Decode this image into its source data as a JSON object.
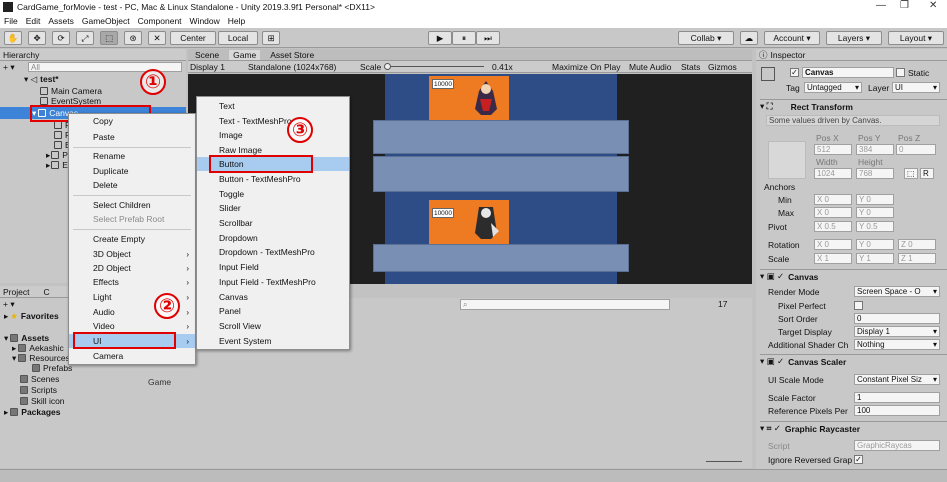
{
  "window": {
    "title": "CardGame_forMovie - test - PC, Mac & Linux Standalone - Unity 2019.3.9f1 Personal* <DX11>",
    "minimize": "—",
    "maximize": "❐",
    "close": "✕"
  },
  "menubar": [
    "File",
    "Edit",
    "Assets",
    "GameObject",
    "Component",
    "Window",
    "Help"
  ],
  "toolbar": {
    "tools": [
      "✋",
      "✥",
      "⟳",
      "⤢",
      "⬚",
      "⊛",
      "✕"
    ],
    "pivot": "Center",
    "space": "Local",
    "snap": "⊞",
    "play": "▶",
    "pause": "⏸",
    "step": "⏭",
    "collab": "Collab ▾",
    "cloud": "☁",
    "account": "Account ▾",
    "layers": "Layers ▾",
    "layout": "Layout ▾"
  },
  "hierarchy": {
    "tab": "Hierarchy",
    "add": "+ ▾",
    "search_placeholder": "All",
    "scene": "test*",
    "items": [
      "Main Camera",
      "EventSystem",
      "Canvas",
      "P",
      "P",
      "E",
      "P",
      "E"
    ]
  },
  "scene_tabs": {
    "scene": "Scene",
    "game": "Game",
    "store": "Asset Store"
  },
  "game_bar": {
    "display": "Display 1",
    "res": "Standalone (1024x768)",
    "scale_label": "Scale",
    "scale_val": "0.41x",
    "maximize": "Maximize On Play",
    "mute": "Mute Audio",
    "stats": "Stats",
    "gizmos": "Gizmos"
  },
  "game_view": {
    "card_top_value": "10000",
    "card_bottom_value": "10000",
    "bg": "#2e4d86",
    "card_color": "#ee7b22"
  },
  "project": {
    "tab": "Project",
    "console": "C",
    "add": "+ ▾",
    "favorites": "Favorites",
    "assets": "Assets",
    "tree": [
      "Aekashic",
      "Resources",
      "Prefabs",
      "Scenes",
      "Scripts",
      "Skill icon"
    ],
    "packages": "Packages",
    "file": "Game",
    "count": "17"
  },
  "context_menu": {
    "items": [
      "Copy",
      "Paste",
      "Rename",
      "Duplicate",
      "Delete",
      "Select Children",
      "Select Prefab Root",
      "Create Empty",
      "3D Object",
      "2D Object",
      "Effects",
      "Light",
      "Audio",
      "Video",
      "UI",
      "Camera"
    ]
  },
  "ui_submenu": {
    "items": [
      "Text",
      "Text - TextMeshPro",
      "Image",
      "Raw Image",
      "Button",
      "Button - TextMeshPro",
      "Toggle",
      "Slider",
      "Scrollbar",
      "Dropdown",
      "Dropdown - TextMeshPro",
      "Input Field",
      "Input Field - TextMeshPro",
      "Canvas",
      "Panel",
      "Scroll View",
      "Event System"
    ]
  },
  "callouts": [
    "①",
    "②",
    "③"
  ],
  "inspector": {
    "tab": "Inspector",
    "name": "Canvas",
    "static": "Static",
    "tag_label": "Tag",
    "tag": "Untagged",
    "layer_label": "Layer",
    "layer": "UI",
    "rect": {
      "title": "Rect Transform",
      "note": "Some values driven by Canvas.",
      "posx": "Pos X",
      "posy": "Pos Y",
      "posz": "Pos Z",
      "vx": "512",
      "vy": "384",
      "vz": "0",
      "width": "Width",
      "height": "Height",
      "w": "1024",
      "h": "768",
      "r": "R",
      "anchors": "Anchors",
      "min": "Min",
      "max": "Max",
      "pivot": "Pivot",
      "rotation": "Rotation",
      "scale": "Scale",
      "min_x": "X 0",
      "min_y": "Y 0",
      "max_x": "X 0",
      "max_y": "Y 0",
      "piv_x": "X 0.5",
      "piv_y": "Y 0.5",
      "rot_x": "X 0",
      "rot_y": "Y 0",
      "rot_z": "Z 0",
      "sc_x": "X 1",
      "sc_y": "Y 1",
      "sc_z": "Z 1"
    },
    "canvas": {
      "title": "Canvas",
      "render_mode": "Render Mode",
      "render_val": "Screen Space - O",
      "pixel_perfect": "Pixel Perfect",
      "sort_order": "Sort Order",
      "sort_val": "0",
      "target_display": "Target Display",
      "display_val": "Display 1",
      "shader": "Additional Shader Ch",
      "shader_val": "Nothing"
    },
    "scaler": {
      "title": "Canvas Scaler",
      "scale_mode": "UI Scale Mode",
      "scale_val": "Constant Pixel Siz",
      "factor": "Scale Factor",
      "factor_val": "1",
      "ref": "Reference Pixels Per",
      "ref_val": "100"
    },
    "raycaster": {
      "title": "Graphic Raycaster",
      "script": "Script",
      "script_val": "GraphicRaycas",
      "ignore": "Ignore Reversed Grap",
      "check": "✓"
    }
  }
}
